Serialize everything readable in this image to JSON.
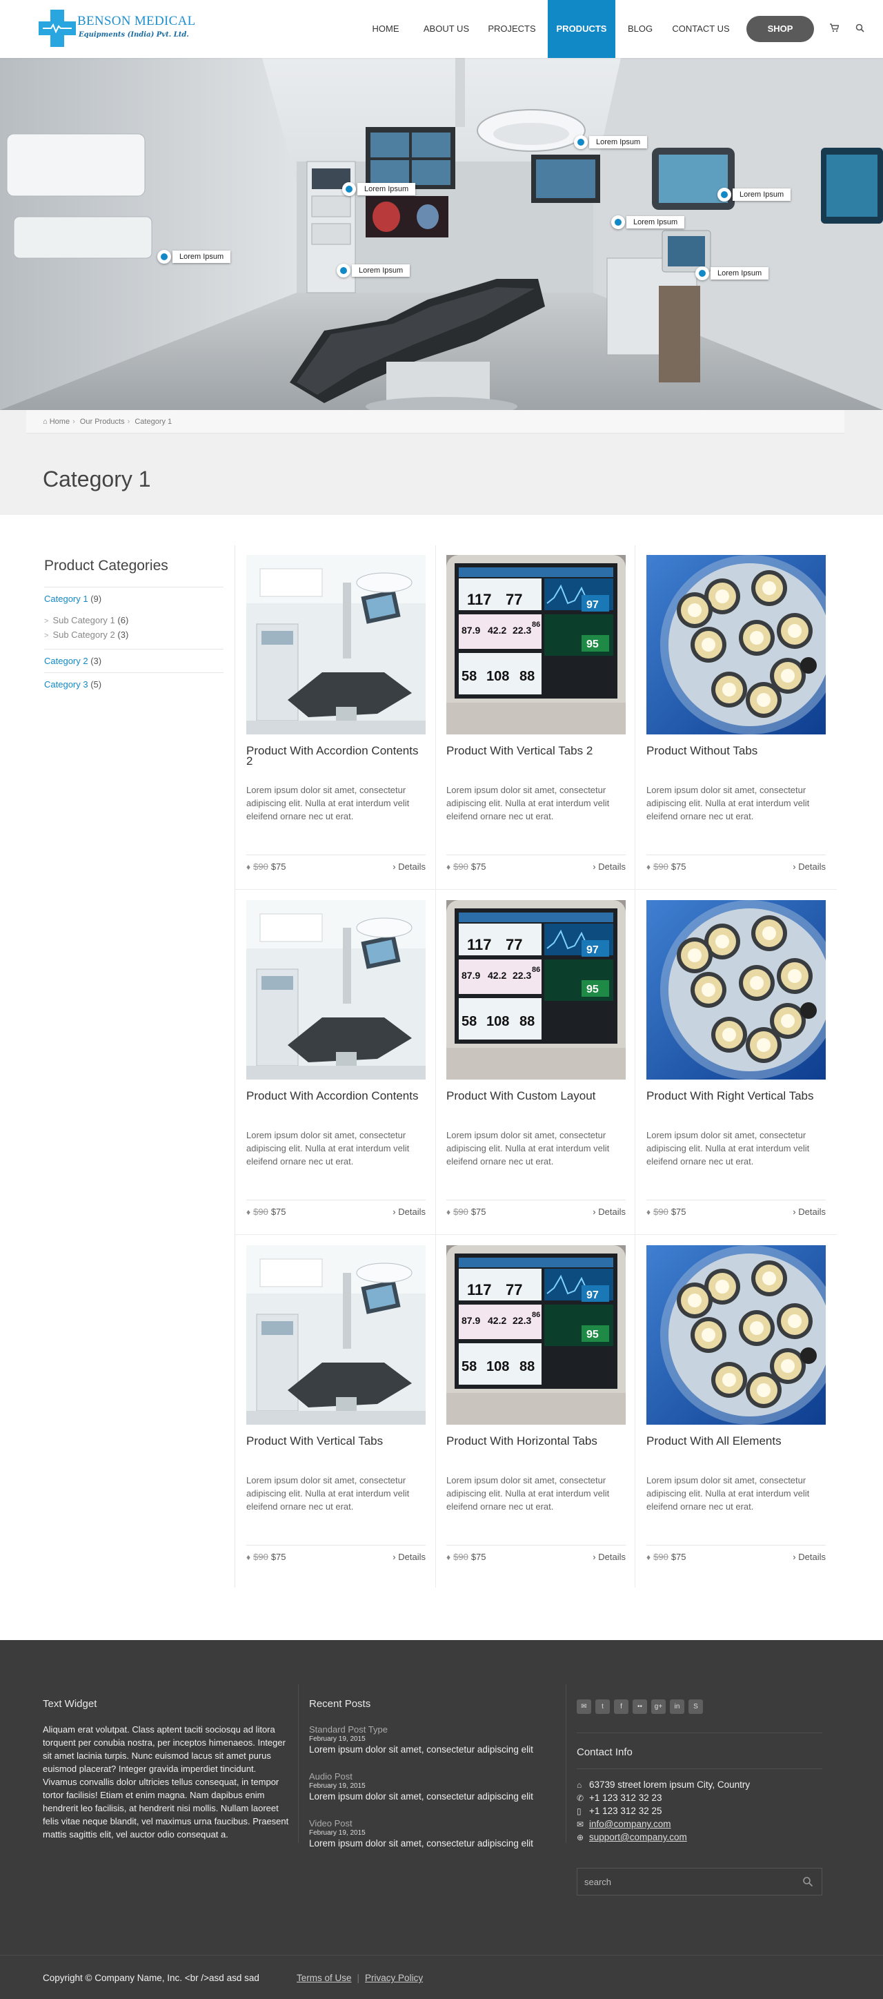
{
  "brand": {
    "name": "BENSON MEDICAL",
    "tagline": "Equipments (India) Pvt. Ltd.",
    "accent": "#1289c7"
  },
  "nav": {
    "items": [
      "Home",
      "About Us",
      "Projects",
      "Products",
      "Blog",
      "Contact Us"
    ],
    "active": "Products",
    "shop_label": "Shop",
    "cart_icon": "cart-icon",
    "search_icon": "search-icon"
  },
  "hero": {
    "hotspots": [
      "Lorem Ipsum",
      "Lorem Ipsum",
      "Lorem Ipsum",
      "Lorem Ipsum",
      "Lorem Ipsum",
      "Lorem Ipsum",
      "Lorem Ipsum"
    ]
  },
  "breadcrumb": [
    "Home",
    "Our Products",
    "Category 1"
  ],
  "page": {
    "title": "Category 1"
  },
  "sidebar": {
    "title": "Product Categories",
    "categories": [
      {
        "label": "Category 1",
        "count": "(9)"
      },
      {
        "label": "Category 2",
        "count": "(3)"
      },
      {
        "label": "Category 3",
        "count": "(5)"
      }
    ],
    "subcategories": [
      {
        "label": "Sub Category 1",
        "count": "(6)"
      },
      {
        "label": "Sub Category 2",
        "count": "(3)"
      }
    ]
  },
  "products": [
    {
      "name": "Product With Accordion Contents 2",
      "desc": "Lorem ipsum dolor sit amet, consectetur adipiscing elit. Nulla at erat interdum velit eleifend ornare nec ut erat.",
      "old_price": "$90",
      "price": "$75",
      "details": "Details",
      "image": "operating-room"
    },
    {
      "name": "Product With Vertical Tabs 2",
      "desc": "Lorem ipsum dolor sit amet, consectetur adipiscing elit. Nulla at erat interdum velit eleifend ornare nec ut erat.",
      "old_price": "$90",
      "price": "$75",
      "details": "Details",
      "image": "patient-monitor"
    },
    {
      "name": "Product Without Tabs",
      "desc": "Lorem ipsum dolor sit amet, consectetur adipiscing elit. Nulla at erat interdum velit eleifend ornare nec ut erat.",
      "old_price": "$90",
      "price": "$75",
      "details": "Details",
      "image": "surgical-lamp"
    },
    {
      "name": "Product With Accordion Contents",
      "desc": "Lorem ipsum dolor sit amet, consectetur adipiscing elit. Nulla at erat interdum velit eleifend ornare nec ut erat.",
      "old_price": "$90",
      "price": "$75",
      "details": "Details",
      "image": "operating-room"
    },
    {
      "name": "Product With Custom Layout",
      "desc": "Lorem ipsum dolor sit amet, consectetur adipiscing elit. Nulla at erat interdum velit eleifend ornare nec ut erat.",
      "old_price": "$90",
      "price": "$75",
      "details": "Details",
      "image": "patient-monitor"
    },
    {
      "name": "Product With Right Vertical Tabs",
      "desc": "Lorem ipsum dolor sit amet, consectetur adipiscing elit. Nulla at erat interdum velit eleifend ornare nec ut erat.",
      "old_price": "$90",
      "price": "$75",
      "details": "Details",
      "image": "surgical-lamp"
    },
    {
      "name": "Product With Vertical Tabs",
      "desc": "Lorem ipsum dolor sit amet, consectetur adipiscing elit. Nulla at erat interdum velit eleifend ornare nec ut erat.",
      "old_price": "$90",
      "price": "$75",
      "details": "Details",
      "image": "operating-room"
    },
    {
      "name": "Product With Horizontal Tabs",
      "desc": "Lorem ipsum dolor sit amet, consectetur adipiscing elit. Nulla at erat interdum velit eleifend ornare nec ut erat.",
      "old_price": "$90",
      "price": "$75",
      "details": "Details",
      "image": "patient-monitor"
    },
    {
      "name": "Product With All Elements",
      "desc": "Lorem ipsum dolor sit amet, consectetur adipiscing elit. Nulla at erat interdum velit eleifend ornare nec ut erat.",
      "old_price": "$90",
      "price": "$75",
      "details": "Details",
      "image": "surgical-lamp"
    }
  ],
  "monitor_readings": [
    "117",
    "77",
    "97",
    "87.9",
    "42.2",
    "22.3",
    "86",
    "95",
    "58",
    "108",
    "88"
  ],
  "footer": {
    "text_widget": {
      "title": "Text Widget",
      "body": "Aliquam erat volutpat. Class aptent taciti sociosqu ad litora torquent per conubia nostra, per inceptos himenaeos. Integer sit amet lacinia turpis. Nunc euismod lacus sit amet purus euismod placerat? Integer gravida imperdiet tincidunt. Vivamus convallis dolor ultricies tellus consequat, in tempor tortor facilisis! Etiam et enim magna. Nam dapibus enim hendrerit leo facilisis, at hendrerit nisi mollis. Nullam laoreet felis vitae neque blandit, vel maximus urna faucibus. Praesent mattis sagittis elit, vel auctor odio consequat a."
    },
    "recent_posts": {
      "title": "Recent Posts",
      "posts": [
        {
          "type": "Standard Post Type",
          "date": "February 19, 2015",
          "title": "Lorem ipsum dolor sit amet, consectetur adipiscing elit"
        },
        {
          "type": "Audio Post",
          "date": "February 19, 2015",
          "title": "Lorem ipsum dolor sit amet, consectetur adipiscing elit"
        },
        {
          "type": "Video Post",
          "date": "February 19, 2015",
          "title": "Lorem ipsum dolor sit amet, consectetur adipiscing elit"
        }
      ]
    },
    "social_icons": [
      "mail-icon",
      "twitter-icon",
      "facebook-icon",
      "flickr-icon",
      "google-plus-icon",
      "linkedin-icon",
      "skype-icon"
    ],
    "contact": {
      "title": "Contact Info",
      "address": "63739 street lorem ipsum City, Country",
      "phone": "+1 123 312 32 23",
      "mobile": "+1 123 312 32 25",
      "email": "info@company.com",
      "support": "support@company.com"
    },
    "search_placeholder": "search",
    "copyright": "Copyright © Company Name, Inc. <br />asd asd sad",
    "links": [
      "Terms of Use",
      "Privacy Policy"
    ]
  }
}
